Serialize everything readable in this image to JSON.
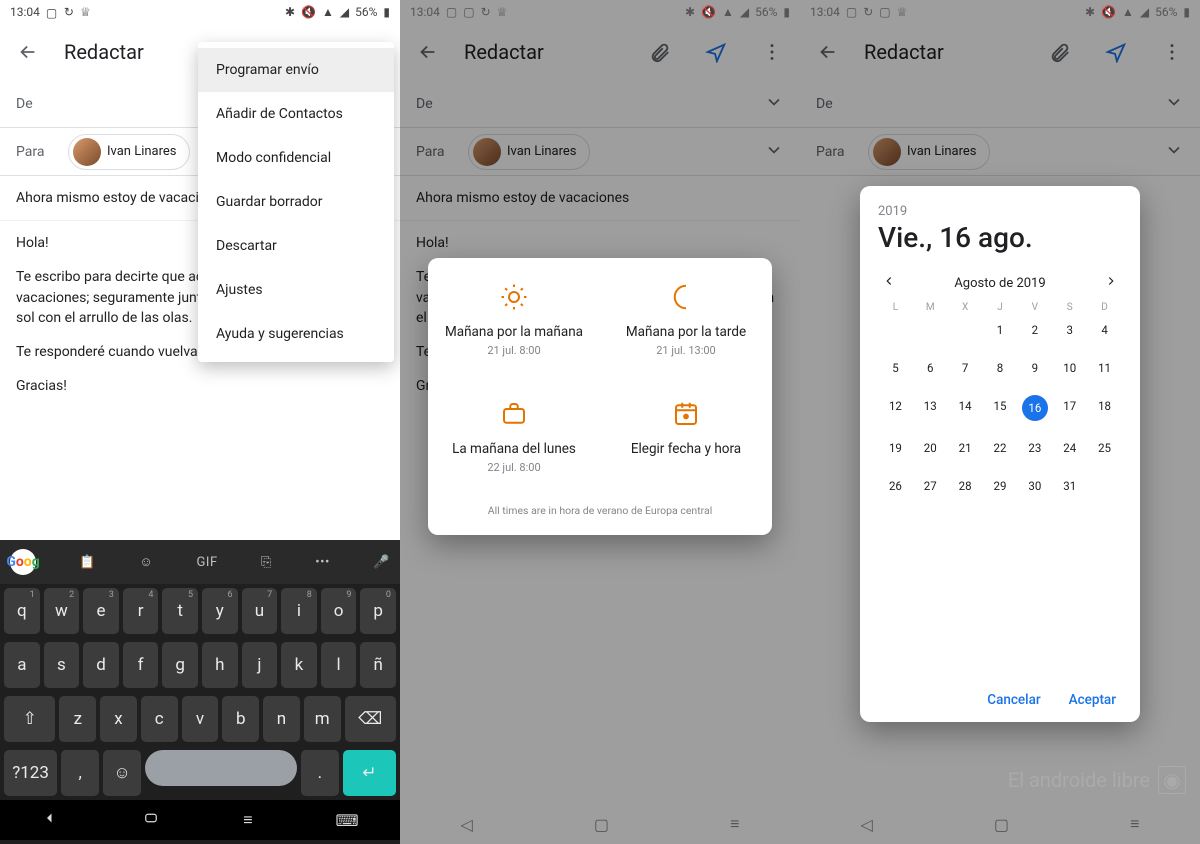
{
  "status": {
    "time": "13:04",
    "battery": "56%"
  },
  "appbar": {
    "title": "Redactar"
  },
  "compose": {
    "from_label": "De",
    "to_label": "Para",
    "recipient": "Ivan Linares",
    "subject": "Ahora mismo estoy de vacaciones",
    "subject_cut": "Ahora mismo estoy de vacacio",
    "body_hola": "Hola!",
    "body_p1_cut": "Te escribo para decirte que act",
    "body_p2_cut": "vacaciones; seguramente junto",
    "body_p3_cut": "sol con el arrullo de las olas.",
    "body_p4_cut": "Te responderé cuando vuelva a",
    "body_gracias": "Gracias!",
    "body_p1_full": "Te escribo para decirte que actualmente estoy de vacaciones; seguramente junto al mar tomando el sol con el arrullo de las olas.",
    "body_p4_full": "Te responderé cuando vuelva al trabajo."
  },
  "menu": {
    "items": [
      "Programar envío",
      "Añadir de Contactos",
      "Modo confidencial",
      "Guardar borrador",
      "Descartar",
      "Ajustes",
      "Ayuda y sugerencias"
    ]
  },
  "keyboard": {
    "gif": "GIF",
    "row1": [
      [
        "q",
        "1"
      ],
      [
        "w",
        "2"
      ],
      [
        "e",
        "3"
      ],
      [
        "r",
        "4"
      ],
      [
        "t",
        "5"
      ],
      [
        "y",
        "6"
      ],
      [
        "u",
        "7"
      ],
      [
        "i",
        "8"
      ],
      [
        "o",
        "9"
      ],
      [
        "p",
        "0"
      ]
    ],
    "row2": [
      "a",
      "s",
      "d",
      "f",
      "g",
      "h",
      "j",
      "k",
      "l",
      "ñ"
    ],
    "row3": [
      "z",
      "x",
      "c",
      "v",
      "b",
      "n",
      "m"
    ],
    "sym": "?123",
    "comma": ",",
    "dot": "."
  },
  "schedule": {
    "opt1": {
      "label": "Mañana por la mañana",
      "sub": "21 jul. 8:00"
    },
    "opt2": {
      "label": "Mañana por la tarde",
      "sub": "21 jul. 13:00"
    },
    "opt3": {
      "label": "La mañana del lunes",
      "sub": "22 jul. 8:00"
    },
    "opt4": {
      "label": "Elegir fecha y hora"
    },
    "tz": "All times are in hora de verano de Europa central"
  },
  "picker": {
    "year": "2019",
    "date": "Vie., 16 ago.",
    "month": "Agosto de 2019",
    "weekdays": [
      "L",
      "M",
      "X",
      "J",
      "V",
      "S",
      "D"
    ],
    "offset": 3,
    "ndays": 31,
    "selected": 16,
    "cancel": "Cancelar",
    "ok": "Aceptar"
  },
  "watermark": "El androide libre"
}
